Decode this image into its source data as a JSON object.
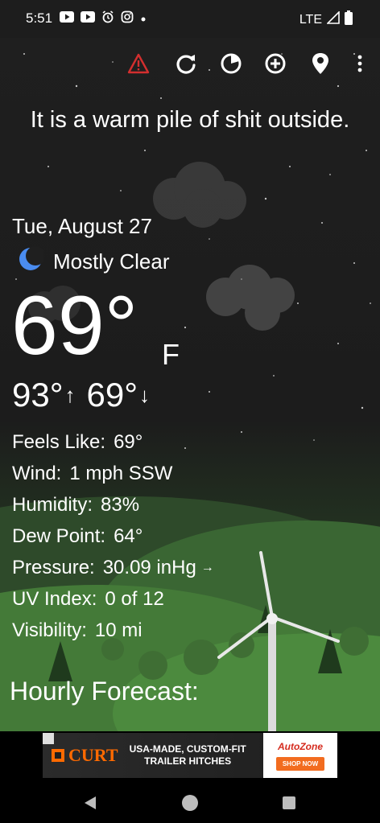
{
  "status_bar": {
    "time": "5:51",
    "network": "LTE",
    "icons": [
      "youtube-icon",
      "youtube-icon",
      "alarm-icon",
      "instagram-icon",
      "dot-icon"
    ]
  },
  "toolbar": {
    "icons": [
      "alert-icon",
      "refresh-icon",
      "radar-icon",
      "add-location-icon",
      "location-pin-icon",
      "more-vert-icon"
    ],
    "alert_color": "#d32f2f"
  },
  "weather": {
    "headline": "It is a warm pile of shit outside.",
    "date": "Tue, August 27",
    "condition": "Mostly Clear",
    "condition_icon": "moon-icon",
    "temperature": "69°",
    "unit": "F",
    "high": "93°",
    "low": "69°",
    "details": [
      {
        "label": "Feels Like:",
        "value": "69°"
      },
      {
        "label": "Wind:",
        "value": "1 mph SSW"
      },
      {
        "label": "Humidity:",
        "value": "83%"
      },
      {
        "label": "Dew Point:",
        "value": "64°"
      },
      {
        "label": "Pressure:",
        "value": "30.09 inHg"
      },
      {
        "label": "UV Index:",
        "value": "0 of 12"
      },
      {
        "label": "Visibility:",
        "value": "10 mi"
      }
    ],
    "pressure_trend": "→"
  },
  "hourly": {
    "title": "Hourly Forecast:"
  },
  "ad": {
    "brand": "CURT",
    "line1": "USA-MADE, CUSTOM-FIT",
    "line2": "TRAILER HITCHES",
    "partner": "AutoZone",
    "cta": "SHOP NOW"
  }
}
